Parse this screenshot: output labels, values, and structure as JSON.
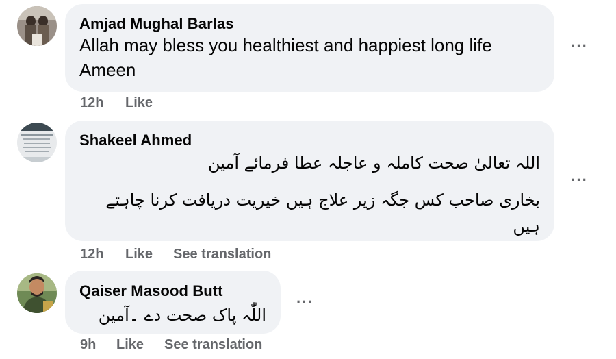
{
  "comments": [
    {
      "author": "Amjad Mughal Barlas",
      "lines": [
        "Allah may bless you healthiest and happiest long life",
        "Ameen"
      ],
      "time": "12h",
      "like": "Like",
      "more": "···"
    },
    {
      "author": "Shakeel Ahmed",
      "lines": [
        "اللہ تعالیٰ صحت کاملہ و عاجلہ عطا فرمائے آمین",
        "بخاری صاحب کس جگہ زیر علاج ہیں خیریت دریافت کرنا چاہتے",
        "ہیں"
      ],
      "time": "12h",
      "like": "Like",
      "translate": "See translation",
      "more": "···"
    },
    {
      "author": "Qaiser Masood Butt",
      "lines": [
        "اللّٰہ پاک صحت دے ۔آمین"
      ],
      "time": "9h",
      "like": "Like",
      "translate": "See translation",
      "more": "···"
    }
  ],
  "colors": {
    "bubble": "#f0f2f5",
    "meta": "#65676b",
    "text": "#050505"
  }
}
